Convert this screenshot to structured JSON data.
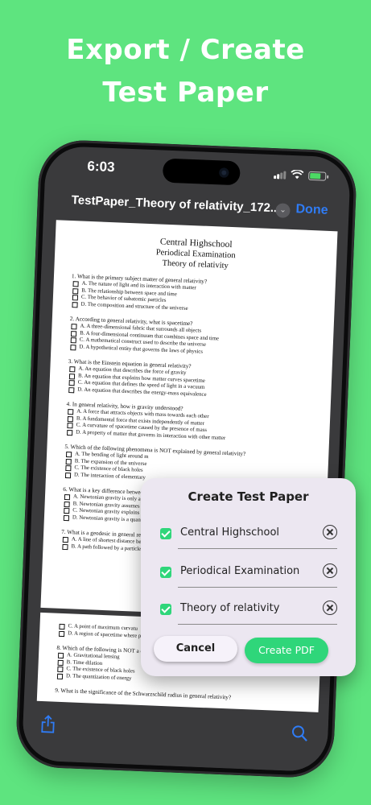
{
  "headline": {
    "line1": "Export / Create",
    "line2": "Test Paper"
  },
  "status_bar": {
    "time": "6:03"
  },
  "nav": {
    "title": "TestPaper_Theory of relativity_172...",
    "done_label": "Done"
  },
  "paper": {
    "school": "Central Highschool",
    "exam": "Periodical Examination",
    "subject": "Theory of relativity",
    "questions": [
      {
        "q": "1. What is the primary subject matter of general relativity?",
        "options": [
          "A. The nature of light and its interaction with matter",
          "B. The relationship between space and time",
          "C. The behavior of subatomic particles",
          "D. The composition and structure of the universe"
        ]
      },
      {
        "q": "2. According to general relativity, what is spacetime?",
        "options": [
          "A. A three-dimensional fabric that surrounds all objects",
          "B. A four-dimensional continuum that combines space and time",
          "C. A mathematical construct used to describe the universe",
          "D. A hypothetical entity that governs the laws of physics"
        ]
      },
      {
        "q": "3. What is the Einstein equation in general relativity?",
        "options": [
          "A. An equation that describes the force of gravity",
          "B. An equation that explains how matter curves spacetime",
          "C. An equation that defines the speed of light in a vacuum",
          "D. An equation that describes the energy-mass equivalence"
        ]
      },
      {
        "q": "4. In general relativity, how is gravity understood?",
        "options": [
          "A. A force that attracts objects with mass towards each other",
          "B. A fundamental force that exists independently of matter",
          "C. A curvature of spacetime caused by the presence of mass",
          "D. A property of matter that governs its interaction with other matter"
        ]
      },
      {
        "q": "5. Which of the following phenomena is NOT explained by general relativity?",
        "options": [
          "A. The bending of light around m",
          "B. The expansion of the universe",
          "C. The existence of black holes",
          "D. The interaction of elementary"
        ]
      },
      {
        "q": "6. What is a key difference between N",
        "options": [
          "A. Newtonian gravity is only app masses",
          "B. Newtonian gravity assumes a",
          "C. Newtonian gravity explains th",
          "D. Newtonian gravity is a quant"
        ]
      },
      {
        "q": "7. What is a geodesic in general relati",
        "options": [
          "A. A line of shortest distance be",
          "B. A path followed by a particle"
        ]
      }
    ],
    "page2": {
      "options_before": [
        "C. A point of maximum curvatu",
        "D. A region of spacetime where p"
      ],
      "q8": "8. Which of the following is NOT a c",
      "q8_options": [
        "A. Gravitational lensing",
        "B. Time dilation",
        "C. The existence of black holes",
        "D. The quantization of energy"
      ],
      "q9": "9. What is the significance of the Schwarzschild radius in general relativity?"
    }
  },
  "dialog": {
    "title": "Create Test Paper",
    "fields": [
      {
        "text": "Central Highschool",
        "checked": true
      },
      {
        "text": "Periodical Examination",
        "checked": true
      },
      {
        "text": "Theory of relativity",
        "checked": true
      }
    ],
    "cancel_label": "Cancel",
    "create_label": "Create PDF"
  },
  "colors": {
    "background": "#5ee47f",
    "accent_green": "#2fd67a",
    "done_blue": "#2f7cf6"
  },
  "icons": [
    "share-icon",
    "search-icon",
    "clear-icon",
    "checkbox-icon",
    "chevron-down-icon"
  ]
}
